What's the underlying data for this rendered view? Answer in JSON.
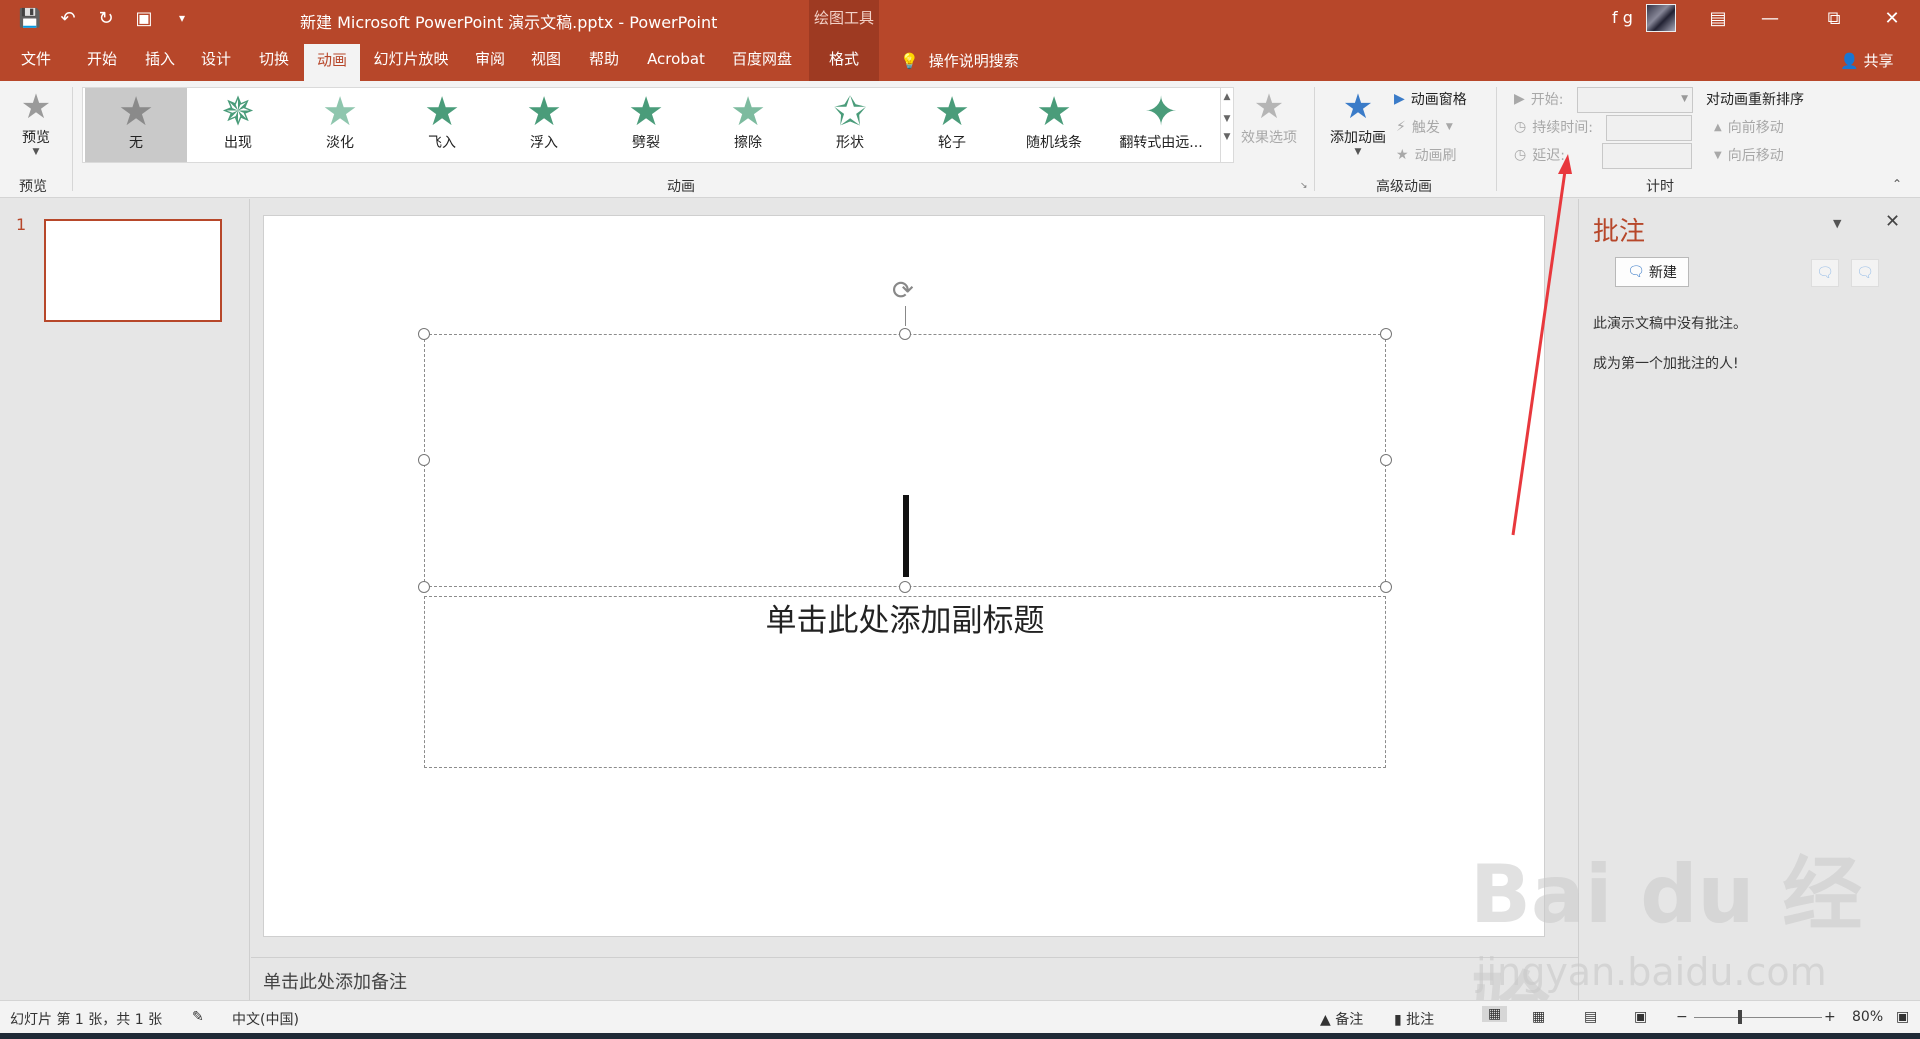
{
  "window": {
    "title": "新建 Microsoft PowerPoint 演示文稿.pptx  -  PowerPoint",
    "context_tool": "绘图工具",
    "user": "f g"
  },
  "tabs": [
    "文件",
    "开始",
    "插入",
    "设计",
    "切换",
    "动画",
    "幻灯片放映",
    "审阅",
    "视图",
    "帮助",
    "Acrobat",
    "百度网盘",
    "格式"
  ],
  "active_tab": "动画",
  "tellme": "操作说明搜索",
  "share": "共享",
  "ribbon": {
    "preview": {
      "label": "预览",
      "group": "预览"
    },
    "animations": {
      "group": "动画",
      "items": [
        "无",
        "出现",
        "淡化",
        "飞入",
        "浮入",
        "劈裂",
        "擦除",
        "形状",
        "轮子",
        "随机线条",
        "翻转式由远..."
      ],
      "selected": "无",
      "effect_options": "效果选项"
    },
    "advanced": {
      "group": "高级动画",
      "add_animation": "添加动画",
      "animation_pane": "动画窗格",
      "trigger": "触发",
      "painter": "动画刷"
    },
    "timing": {
      "group": "计时",
      "start": "开始:",
      "duration": "持续时间:",
      "delay": "延迟:",
      "reorder": "对动画重新排序",
      "move_earlier": "向前移动",
      "move_later": "向后移动"
    }
  },
  "thumbnails": {
    "number": "1"
  },
  "slide": {
    "subtitle_placeholder": "单击此处添加副标题"
  },
  "notes_placeholder": "单击此处添加备注",
  "comments": {
    "title": "批注",
    "new_button": "新建",
    "empty_message": "此演示文稿中没有批注。",
    "prompt": "成为第一个加批注的人!"
  },
  "status": {
    "slide_info": "幻灯片 第 1 张，共 1 张",
    "language": "中文(中国)",
    "notes": "备注",
    "comments": "批注",
    "zoom": "80%"
  },
  "watermark": {
    "brand": "Bai du 经验",
    "url": "jingyan.baidu.com"
  },
  "colors": {
    "accent": "#b7472a",
    "star": "#4a9c7a",
    "annotation_arrow": "#e8383d"
  }
}
